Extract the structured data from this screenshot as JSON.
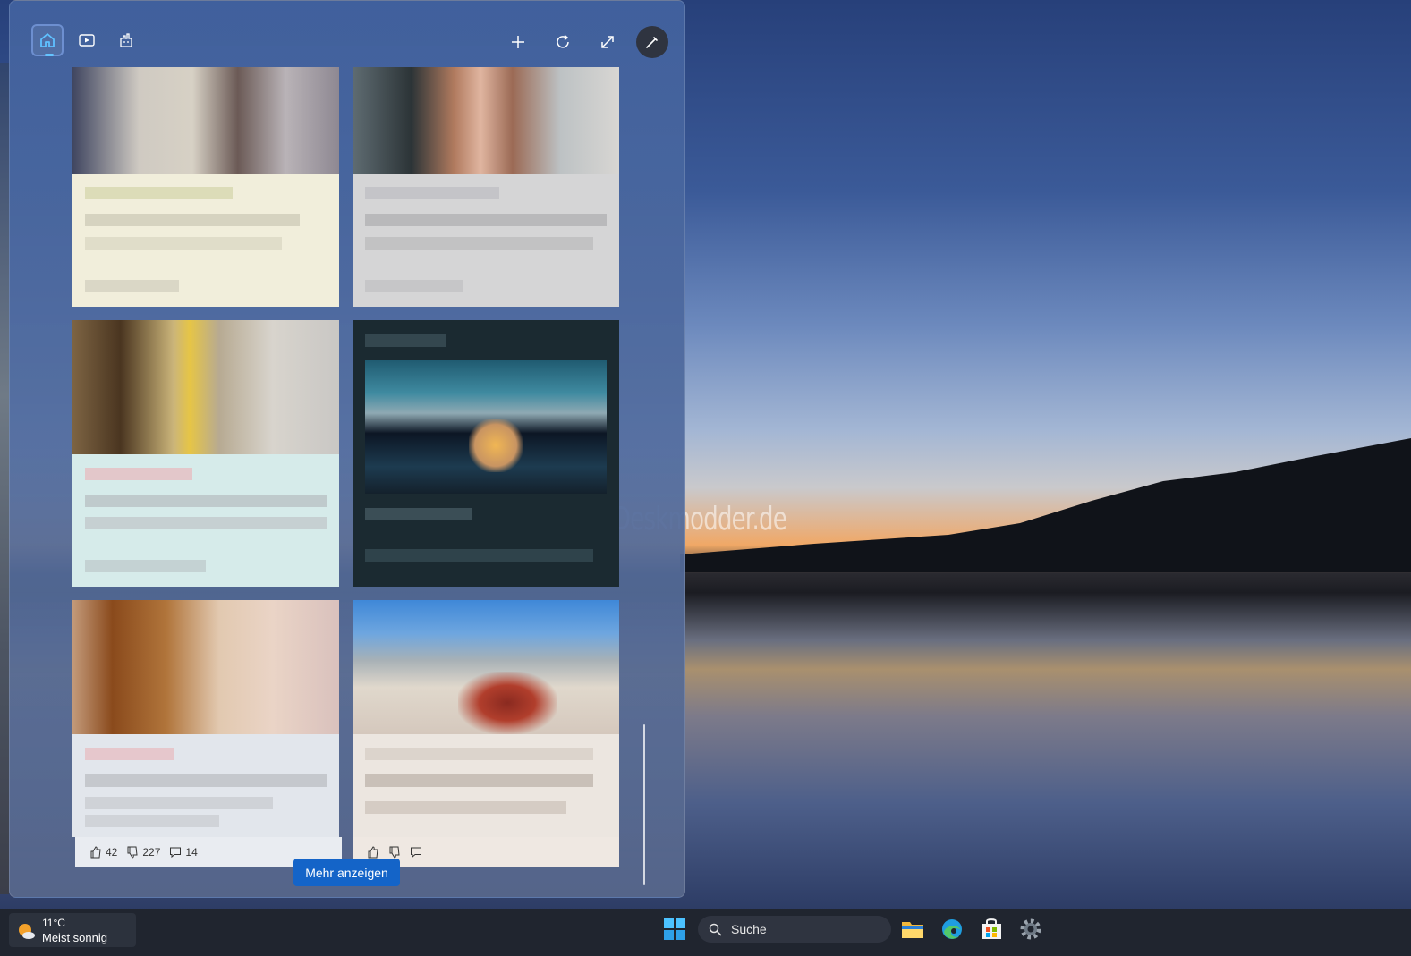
{
  "toolbar": {
    "tabs": [
      {
        "icon": "home-icon",
        "active": true
      },
      {
        "icon": "video-icon",
        "active": false
      },
      {
        "icon": "games-icon",
        "active": false
      }
    ],
    "actions": [
      "add-icon",
      "refresh-icon",
      "expand-icon",
      "personalize-icon"
    ]
  },
  "card_footer": {
    "likes": "42",
    "dislikes": "227",
    "comments": "14"
  },
  "more_button": "Mehr anzeigen",
  "watermark": "Deskmodder.de",
  "taskbar": {
    "weather_temp": "11°C",
    "weather_condition": "Meist sonnig",
    "search_placeholder": "Suche"
  },
  "colors": {
    "accent": "#1464c8",
    "panel": "#42629e",
    "taskbar": "#20252f"
  }
}
